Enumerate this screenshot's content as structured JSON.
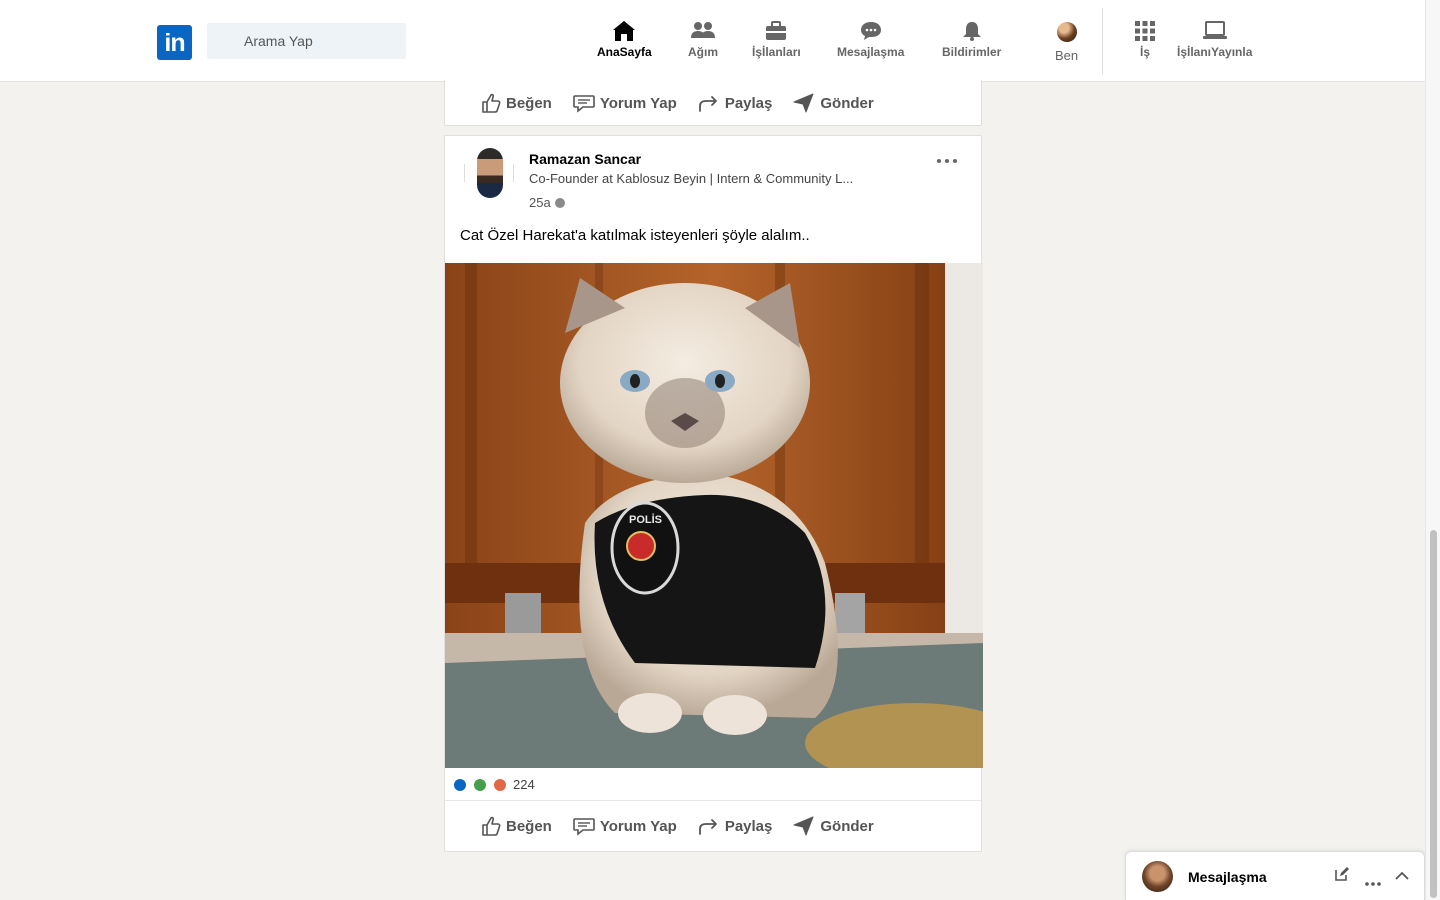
{
  "header": {
    "logo_text": "in",
    "search_placeholder": "Arama Yap",
    "nav": [
      {
        "label": "AnaSayfa",
        "icon": "home-icon",
        "active": true
      },
      {
        "label": "Ağım",
        "icon": "people-icon"
      },
      {
        "label": "İşİlanları",
        "icon": "briefcase-icon"
      },
      {
        "label": "Mesajlaşma",
        "icon": "chat-icon"
      },
      {
        "label": "Bildirimler",
        "icon": "bell-icon"
      },
      {
        "label": "Ben",
        "icon": "avatar"
      },
      {
        "label": "İş",
        "icon": "grid-icon"
      },
      {
        "label": "İşİlanıYayınla",
        "icon": "laptop-icon"
      }
    ]
  },
  "actions": {
    "like": "Beğen",
    "comment": "Yorum Yap",
    "share": "Paylaş",
    "send": "Gönder"
  },
  "post": {
    "author_name": "Ramazan Sancar",
    "author_title": "Co-Founder at Kablosuz Beyin | Intern & Community L...",
    "time": "25a",
    "text": "Cat Özel Harekat'a katılmak isteyenleri şöyle alalım..",
    "image_alt": "POLİS",
    "reaction_count": "224"
  },
  "messaging": {
    "title": "Mesajlaşma"
  },
  "colors": {
    "brand": "#0a66c2",
    "background": "#f3f2ef"
  }
}
